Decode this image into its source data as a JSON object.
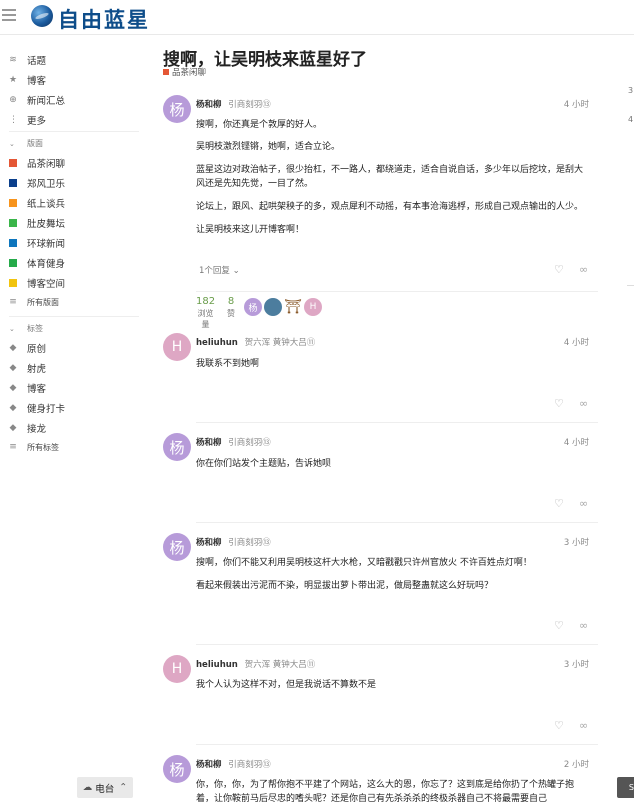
{
  "header": {
    "logo_text": "自由蓝星"
  },
  "sidebar": {
    "top_items": [
      {
        "label": "话题",
        "icon": "layers-icon"
      },
      {
        "label": "博客",
        "icon": "star-icon"
      },
      {
        "label": "新闻汇总",
        "icon": "globe-icon"
      },
      {
        "label": "更多",
        "icon": "more-icon"
      }
    ],
    "categories_header": "版面",
    "categories": [
      {
        "label": "品茶闲聊",
        "color": "#e45735"
      },
      {
        "label": "郑风卫乐",
        "color": "#0b3f8b"
      },
      {
        "label": "纸上谈兵",
        "color": "#f7941d"
      },
      {
        "label": "肚皮舞坛",
        "color": "#3ab54a"
      },
      {
        "label": "环球新闻",
        "color": "#0e76bd"
      },
      {
        "label": "体育健身",
        "color": "#25aa4a"
      },
      {
        "label": "博客空间",
        "color": "#f1c40f"
      }
    ],
    "all_categories": "所有版面",
    "tags_header": "标签",
    "tags": [
      "原创",
      "射虎",
      "博客",
      "健身打卡",
      "接龙"
    ],
    "all_tags": "所有标签",
    "radio_label": "电台"
  },
  "topic": {
    "title": "搜啊，让吴明枝来蓝星好了",
    "category": "品茶闲聊",
    "category_color": "#e45735"
  },
  "posts": [
    {
      "avatar_letter": "杨",
      "username": "杨和柳",
      "user_title": "引商刻羽⑬",
      "time": "4 小时",
      "paragraphs": [
        "搜啊，你还真是个敦厚的好人。",
        "吴明枝激烈铿锵，她啊，适合立论。",
        "蓝星这边对政治帖子，很少抬杠，不一路人，都绕道走，适合自说自话，多少年以后挖坟，是刮大",
        "风还是先知先觉，一目了然。",
        "论坛上，跟风、起哄架秧子的多，观点犀利不动摇，有本事沧海逃桴，形成自己观点输出的人少。",
        "让吴明枝来这儿开博客啊！"
      ],
      "replies": "1个回复",
      "views": "182",
      "views_label": "浏览量",
      "likes": "8",
      "likes_label": "赞"
    },
    {
      "avatar_letter": "H",
      "username": "heliuhun",
      "user_title": "贺六浑  黄钟大吕⑪",
      "time": "4 小时",
      "paragraphs": [
        "我联系不到她啊"
      ]
    },
    {
      "avatar_letter": "杨",
      "username": "杨和柳",
      "user_title": "引商刻羽⑬",
      "time": "4 小时",
      "paragraphs": [
        "你在你们站发个主题贴，告诉她呗"
      ]
    },
    {
      "avatar_letter": "杨",
      "username": "杨和柳",
      "user_title": "引商刻羽⑬",
      "time": "3 小时",
      "paragraphs": [
        "搜啊，你们不能又利用吴明枝这杆大水枪，又暗戳戳只许州官放火 不许百姓点灯啊！",
        "看起来假装出污泥而不染，明显拔出萝卜带出泥，做局整蛊就这么好玩吗？"
      ]
    },
    {
      "avatar_letter": "H",
      "username": "heliuhun",
      "user_title": "贺六浑  黄钟大吕⑪",
      "time": "3 小时",
      "paragraphs": [
        "我个人认为这样不对，但是我说话不算数不是"
      ]
    },
    {
      "avatar_letter": "杨",
      "username": "杨和柳",
      "user_title": "引商刻羽⑬",
      "time": "2 小时",
      "paragraphs": [
        "你，你，你，为了帮你抱不平建了个网站，这么大的恩，你忘了？这到底是给你扔了个热罐子抱",
        "着，让你鞍前马后尽忠的嗜头呢？还是你自己有先杀杀杀的终极杀器自己不将最需要自己"
      ]
    }
  ],
  "right_margin": {
    "nums": [
      "3",
      "4"
    ],
    "corner_label": "S"
  }
}
